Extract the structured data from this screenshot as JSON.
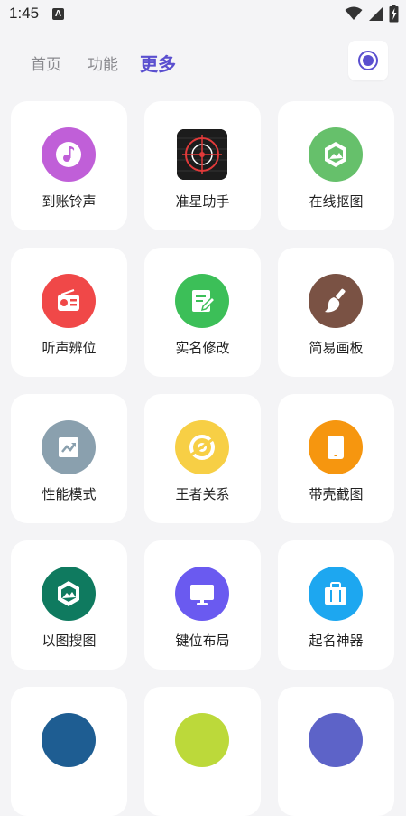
{
  "status_bar": {
    "time": "1:45",
    "badge": "A"
  },
  "tabs": [
    {
      "label": "首页",
      "active": false
    },
    {
      "label": "功能",
      "active": false
    },
    {
      "label": "更多",
      "active": true
    }
  ],
  "colors": {
    "accent": "#5a4fcf",
    "background": "#f4f4f6"
  },
  "tools": [
    {
      "label": "到账铃声",
      "icon": "music-note-icon",
      "color": "#c05fd8"
    },
    {
      "label": "准星助手",
      "icon": "crosshair-icon",
      "color": "#1c1c1c"
    },
    {
      "label": "在线抠图",
      "icon": "image-cutout-icon",
      "color": "#66c06b"
    },
    {
      "label": "听声辨位",
      "icon": "radio-icon",
      "color": "#f04848"
    },
    {
      "label": "实名修改",
      "icon": "edit-note-icon",
      "color": "#3cbf58"
    },
    {
      "label": "简易画板",
      "icon": "brush-icon",
      "color": "#7a5244"
    },
    {
      "label": "性能模式",
      "icon": "trending-up-icon",
      "color": "#8aa0ae"
    },
    {
      "label": "王者关系",
      "icon": "disc-icon",
      "color": "#f7cf45"
    },
    {
      "label": "带壳截图",
      "icon": "phone-frame-icon",
      "color": "#f6960f"
    },
    {
      "label": "以图搜图",
      "icon": "image-search-icon",
      "color": "#0f7a5f"
    },
    {
      "label": "键位布局",
      "icon": "monitor-icon",
      "color": "#6a5af0"
    },
    {
      "label": "起名神器",
      "icon": "briefcase-icon",
      "color": "#1da7f0"
    }
  ],
  "partial_row_colors": [
    "#1e5d92",
    "#bcd93a",
    "#5d63c8"
  ]
}
